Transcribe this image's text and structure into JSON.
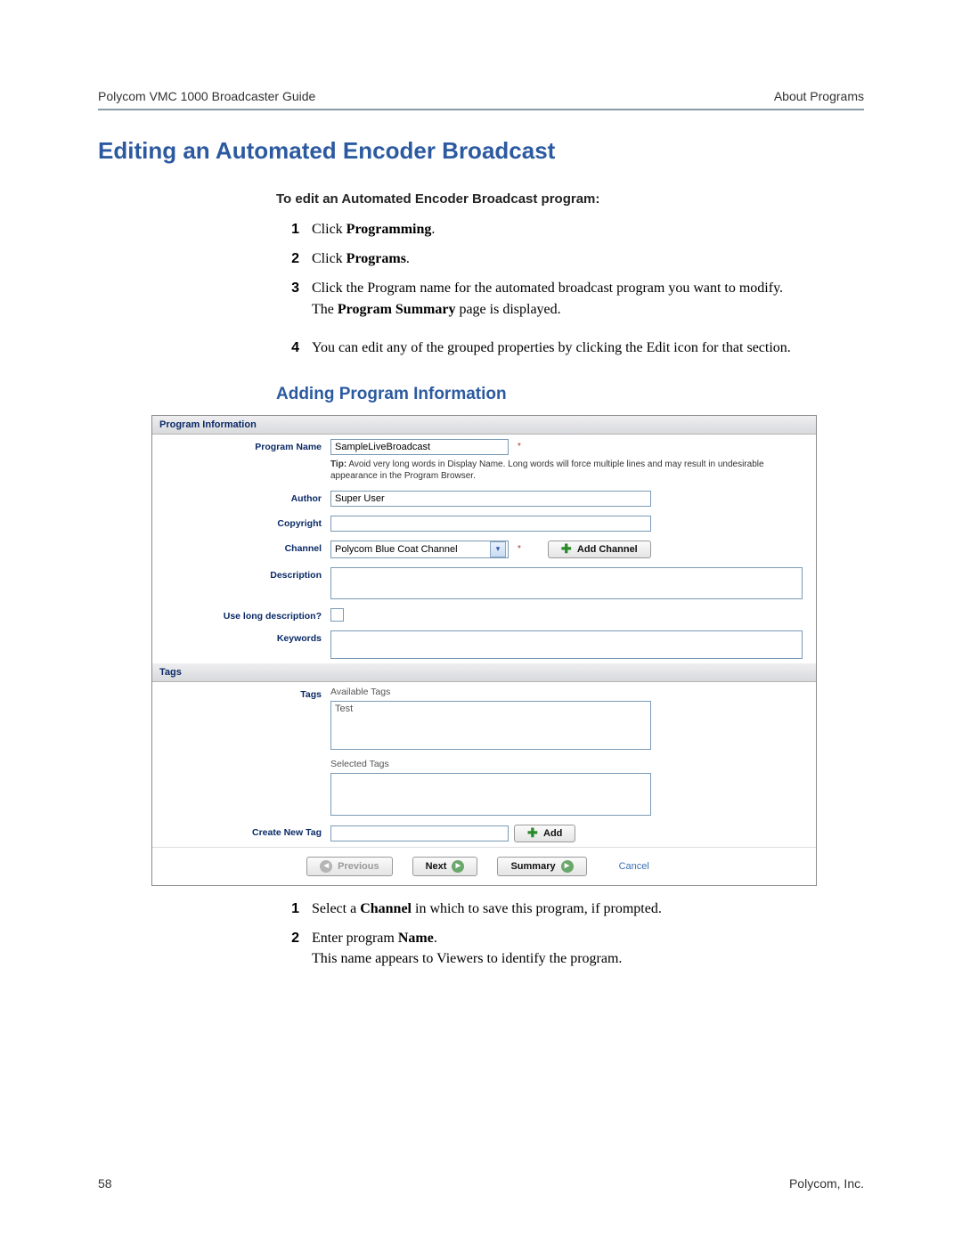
{
  "header": {
    "left": "Polycom VMC 1000 Broadcaster Guide",
    "right": "About Programs"
  },
  "section_title": "Editing an Automated Encoder Broadcast",
  "lead": "To edit an Automated Encoder Broadcast program:",
  "steps_top": [
    {
      "num": "1",
      "html": "Click <b>Programming</b>."
    },
    {
      "num": "2",
      "html": "Click <b>Programs</b>."
    },
    {
      "num": "3",
      "html": "Click the Program name for the automated broadcast program you want to modify.<p>The <b>Program Summary</b> page is displayed.</p>"
    },
    {
      "num": "4",
      "html": "You can edit any of the grouped properties by clicking the Edit icon for that section."
    }
  ],
  "subsection_title": "Adding Program Information",
  "form": {
    "section1": "Program Information",
    "program_name_label": "Program Name",
    "program_name_value": "SampleLiveBroadcast",
    "tip": "Avoid very long words in Display Name. Long words will force multiple lines and may result in undesirable appearance in the Program Browser.",
    "tip_prefix": "Tip:",
    "author_label": "Author",
    "author_value": "Super User",
    "copyright_label": "Copyright",
    "copyright_value": "",
    "channel_label": "Channel",
    "channel_value": "Polycom Blue Coat Channel",
    "add_channel": "Add Channel",
    "description_label": "Description",
    "description_value": "",
    "longdesc_label": "Use long description?",
    "keywords_label": "Keywords",
    "keywords_value": "",
    "section2": "Tags",
    "tags_label": "Tags",
    "available_tags_label": "Available Tags",
    "available_tags_item": "Test",
    "selected_tags_label": "Selected Tags",
    "create_tag_label": "Create New Tag",
    "create_tag_value": "",
    "add_btn": "Add",
    "prev": "Previous",
    "next": "Next",
    "summary": "Summary",
    "cancel": "Cancel"
  },
  "steps_bottom": [
    {
      "num": "1",
      "html": "Select a <b>Channel</b> in which to save this program, if prompted."
    },
    {
      "num": "2",
      "html": "Enter program <b>Name</b>.<p>This name appears to Viewers to identify the program.</p>"
    }
  ],
  "footer": {
    "page": "58",
    "company": "Polycom, Inc."
  }
}
